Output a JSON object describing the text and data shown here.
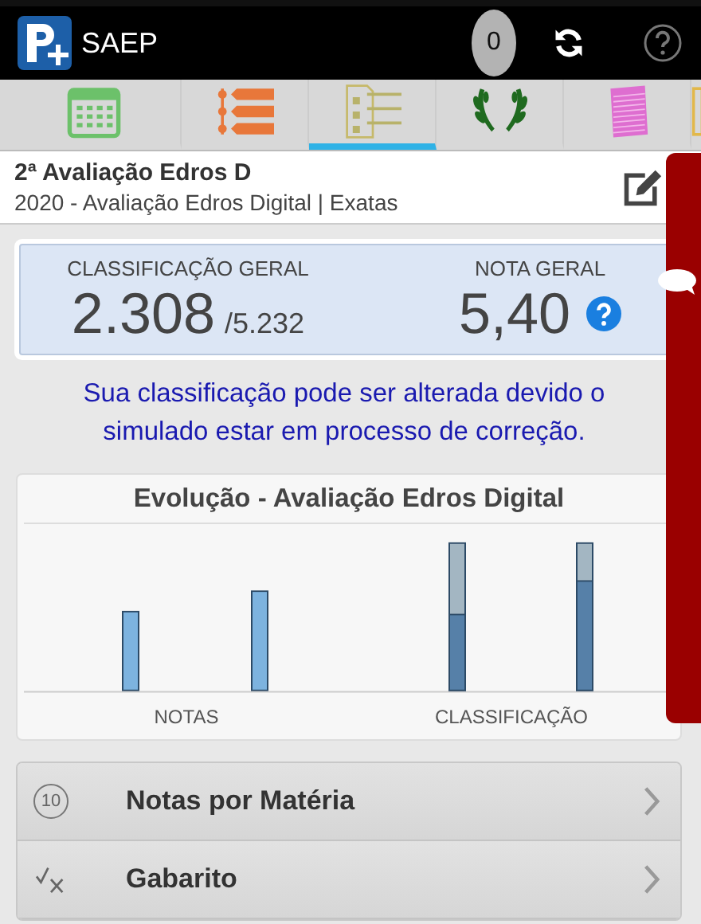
{
  "app_bar": {
    "title": "SAEP",
    "counter": "0"
  },
  "tabs": [
    {
      "kind": "calendar",
      "selected": false
    },
    {
      "kind": "list",
      "selected": false
    },
    {
      "kind": "checklist",
      "selected": true
    },
    {
      "kind": "laurel",
      "selected": false
    },
    {
      "kind": "notebook",
      "selected": false
    },
    {
      "kind": "partial",
      "selected": false
    }
  ],
  "header": {
    "title": "2ª Avaliação Edros D",
    "subtitle": "2020 - Avaliação Edros Digital | Exatas"
  },
  "score": {
    "rank_label": "CLASSIFICAÇÃO GERAL",
    "rank": "2.308",
    "rank_total": "/5.232",
    "grade_label": "NOTA GERAL",
    "grade": "5,40"
  },
  "notice": "Sua classificação pode ser alterada devido o simulado estar em processo de correção.",
  "chart": {
    "title": "Evolução - Avaliação Edros Digital",
    "categories": [
      "NOTAS",
      "CLASSIFICAÇÃO"
    ]
  },
  "menu": [
    {
      "kind": "score",
      "badge": "10",
      "label": "Notas por Matéria"
    },
    {
      "kind": "answers",
      "label": "Gabarito"
    }
  ]
}
